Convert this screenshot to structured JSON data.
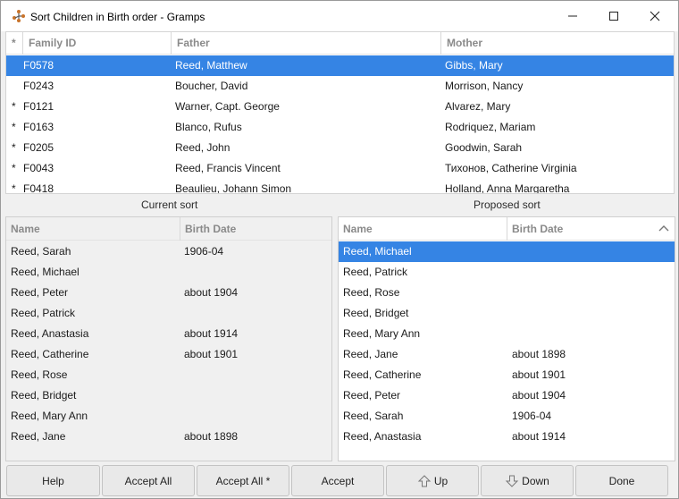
{
  "window": {
    "title": "Sort Children in Birth order - Gramps",
    "app_icon": "gramps-tree-icon"
  },
  "family_table": {
    "columns": [
      "*",
      "Family ID",
      "Father",
      "Mother"
    ],
    "rows": [
      {
        "marker": "",
        "id": "F0578",
        "father": "Reed, Matthew",
        "mother": "Gibbs, Mary",
        "selected": true
      },
      {
        "marker": "",
        "id": "F0243",
        "father": "Boucher, David",
        "mother": "Morrison, Nancy"
      },
      {
        "marker": "*",
        "id": "F0121",
        "father": "Warner, Capt. George",
        "mother": "Alvarez, Mary"
      },
      {
        "marker": "*",
        "id": "F0163",
        "father": "Blanco, Rufus",
        "mother": "Rodriquez, Mariam"
      },
      {
        "marker": "*",
        "id": "F0205",
        "father": "Reed, John",
        "mother": "Goodwin, Sarah"
      },
      {
        "marker": "*",
        "id": "F0043",
        "father": "Reed, Francis Vincent",
        "mother": "Тихонов, Catherine Virginia"
      },
      {
        "marker": "*",
        "id": "F0418",
        "father": "Beaulieu, Johann Simon",
        "mother": "Holland, Anna Margaretha"
      }
    ]
  },
  "current_sort": {
    "label": "Current sort",
    "columns": [
      "Name",
      "Birth Date"
    ],
    "rows": [
      {
        "name": "Reed, Sarah",
        "birth": "1906-04"
      },
      {
        "name": "Reed, Michael",
        "birth": ""
      },
      {
        "name": "Reed, Peter",
        "birth": "about 1904"
      },
      {
        "name": "Reed, Patrick",
        "birth": ""
      },
      {
        "name": "Reed, Anastasia",
        "birth": "about 1914"
      },
      {
        "name": "Reed, Catherine",
        "birth": "about 1901"
      },
      {
        "name": "Reed, Rose",
        "birth": ""
      },
      {
        "name": "Reed, Bridget",
        "birth": ""
      },
      {
        "name": "Reed, Mary Ann",
        "birth": ""
      },
      {
        "name": "Reed, Jane",
        "birth": "about 1898"
      }
    ]
  },
  "proposed_sort": {
    "label": "Proposed sort",
    "columns": [
      "Name",
      "Birth Date"
    ],
    "rows": [
      {
        "name": "Reed, Michael",
        "birth": "",
        "selected": true
      },
      {
        "name": "Reed, Patrick",
        "birth": ""
      },
      {
        "name": "Reed, Rose",
        "birth": ""
      },
      {
        "name": "Reed, Bridget",
        "birth": ""
      },
      {
        "name": "Reed, Mary Ann",
        "birth": ""
      },
      {
        "name": "Reed, Jane",
        "birth": "about 1898"
      },
      {
        "name": "Reed, Catherine",
        "birth": "about 1901"
      },
      {
        "name": "Reed, Peter",
        "birth": "about 1904"
      },
      {
        "name": "Reed, Sarah",
        "birth": "1906-04"
      },
      {
        "name": "Reed, Anastasia",
        "birth": "about 1914"
      }
    ]
  },
  "buttons": {
    "help": "Help",
    "accept_all": "Accept All",
    "accept_all_star": "Accept All *",
    "accept": "Accept",
    "up": "Up",
    "down": "Down",
    "done": "Done"
  },
  "colors": {
    "selection": "#3584e4",
    "header_text": "#8a8a8a"
  }
}
